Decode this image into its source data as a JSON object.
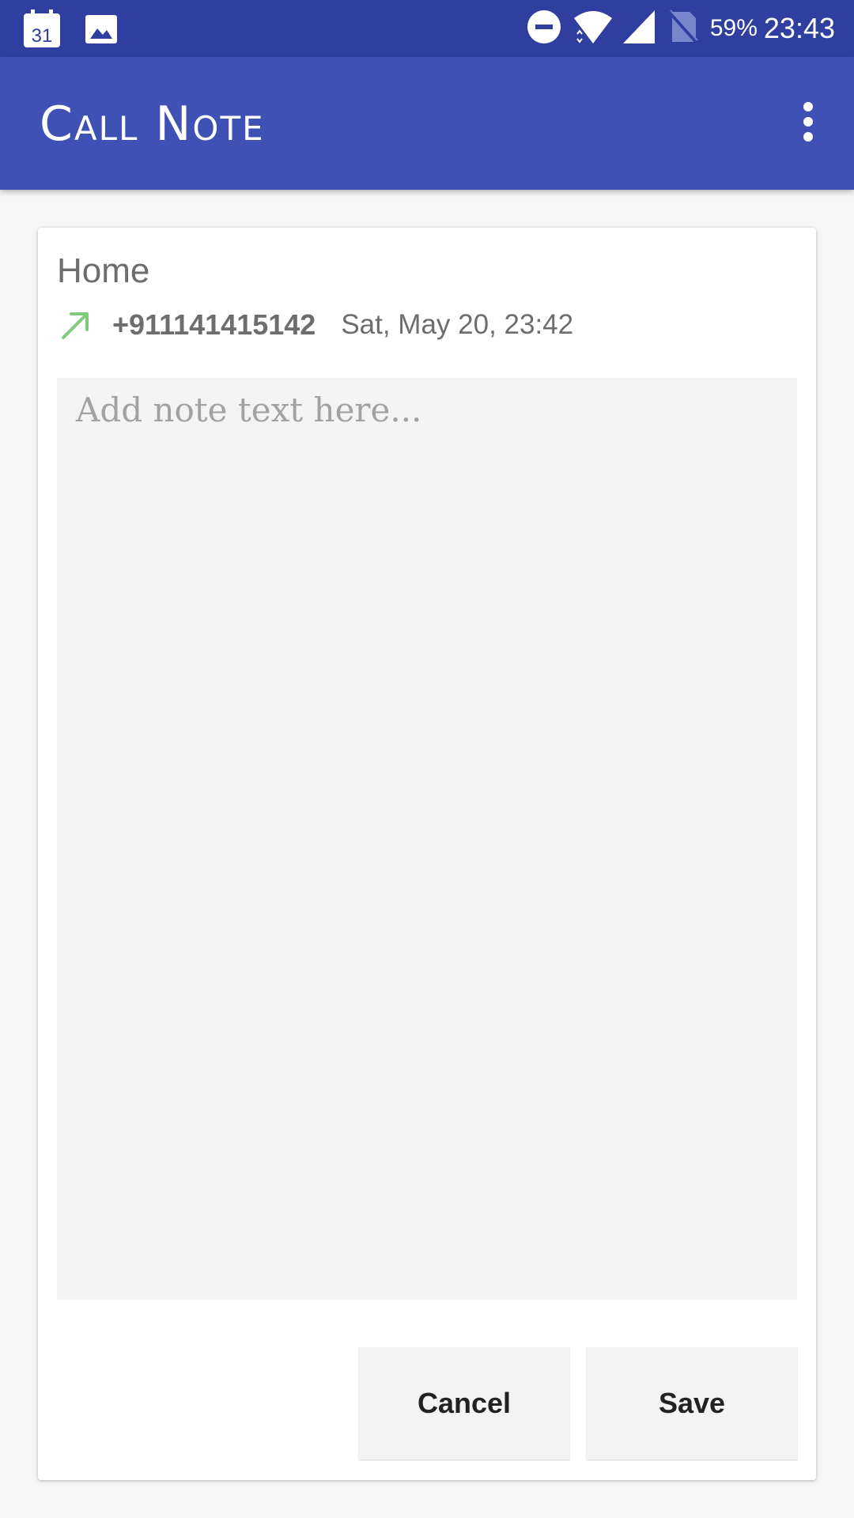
{
  "status_bar": {
    "calendar_day": "31",
    "battery": "59%",
    "time": "23:43",
    "icons": [
      "calendar-icon",
      "gallery-icon",
      "do-not-disturb-icon",
      "wifi-icon",
      "cellular-signal-icon",
      "no-sim-icon"
    ]
  },
  "app_bar": {
    "title": "Call Note",
    "overflow_icon": "more-vert-icon"
  },
  "call": {
    "contact_name": "Home",
    "direction_icon": "outgoing-call-arrow-icon",
    "phone_number": "+911141415142",
    "timestamp": "Sat, May 20, 23:42"
  },
  "note": {
    "value": "",
    "placeholder": "Add note text here..."
  },
  "actions": {
    "cancel_label": "Cancel",
    "save_label": "Save"
  },
  "colors": {
    "status_bar": "#303f9f",
    "app_bar": "#3f51b5",
    "outgoing_arrow": "#7ecb7e",
    "secondary_text": "#6d6d6d",
    "note_background": "#f4f4f4"
  }
}
